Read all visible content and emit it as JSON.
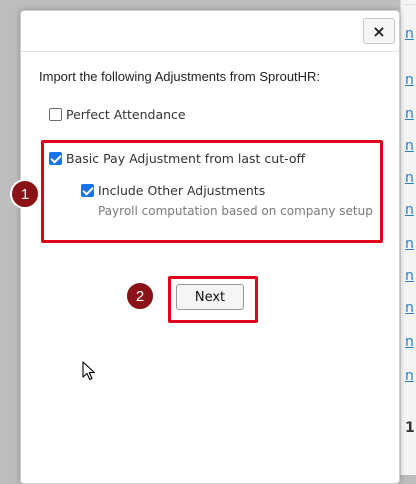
{
  "dialog": {
    "close_label": "×",
    "intro": "Import the following Adjustments from SproutHR:",
    "options": [
      {
        "label": "Perfect Attendance",
        "checked": false
      },
      {
        "label": "Basic Pay Adjustment from last cut-off",
        "checked": true
      },
      {
        "label": "Include Other Adjustments",
        "checked": true
      }
    ],
    "sub_note": "Payroll computation based on company setup",
    "next_label": "Next"
  },
  "steps": [
    "1",
    "2"
  ],
  "background": {
    "links": [
      "n",
      "n",
      "n",
      "n",
      "n",
      "n",
      "n",
      "n",
      "n",
      "n",
      "n"
    ],
    "page_number": "1"
  },
  "colors": {
    "highlight": "#e0001b",
    "step_badge": "#8b1216",
    "checkbox": "#1a73e8"
  }
}
